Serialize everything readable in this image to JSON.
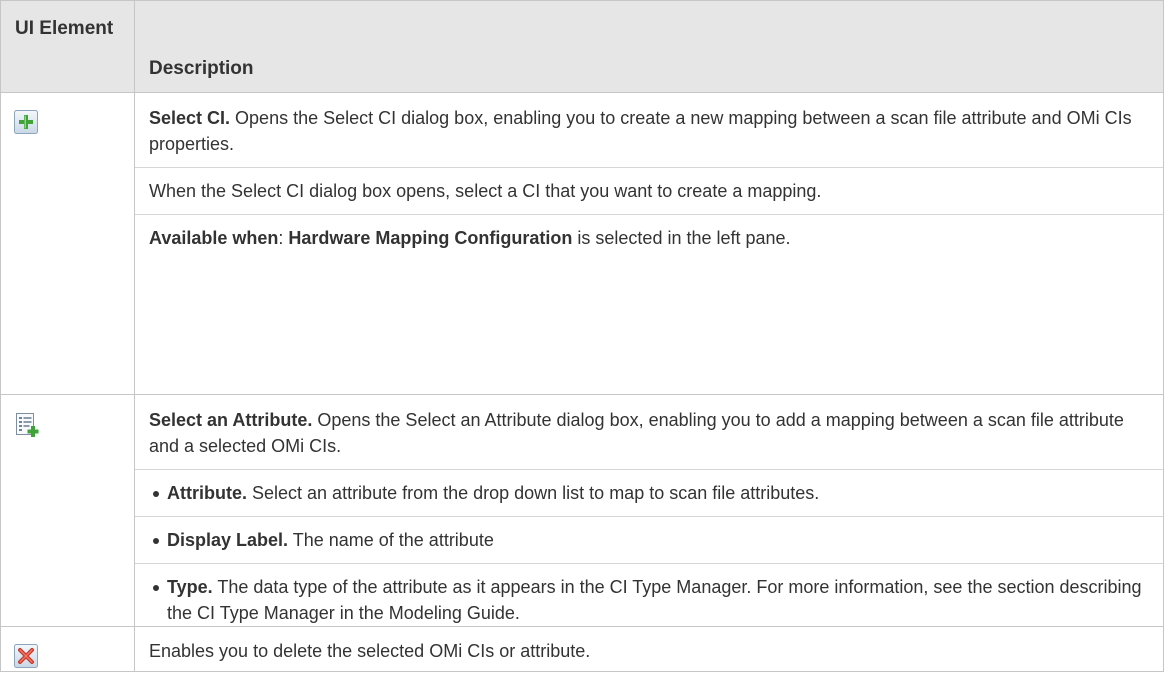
{
  "header": {
    "col_element": "UI Element",
    "col_description": "Description"
  },
  "rows": [
    {
      "icon": "add-plus-icon",
      "title": "Select CI.",
      "text": " Opens the Select CI dialog box, enabling you to create a new mapping between a scan file attribute and OMi CIs properties.",
      "note": "When the Select CI dialog box opens, select a CI that you want to create a mapping.",
      "avail_label": "Available when",
      "avail_sep": ": ",
      "avail_value": "Hardware Mapping Configuration",
      "avail_suffix": " is selected in the left pane."
    },
    {
      "icon": "list-add-icon",
      "title": "Select an Attribute.",
      "text": " Opens the Select an Attribute dialog box, enabling you to add a mapping between a scan file attribute and a selected OMi CIs.",
      "bullets": [
        {
          "label": "Attribute.",
          "text": " Select an attribute from the drop down list to map to scan file attributes."
        },
        {
          "label": "Display Label.",
          "text": " The name of the attribute"
        },
        {
          "label": "Type.",
          "text": " The data type of the attribute as it appears in the CI Type Manager. For more information, see the section describing the CI Type Manager in the Modeling Guide."
        }
      ]
    },
    {
      "icon": "delete-x-icon",
      "text": "Enables you to delete the selected OMi CIs or attribute."
    }
  ]
}
